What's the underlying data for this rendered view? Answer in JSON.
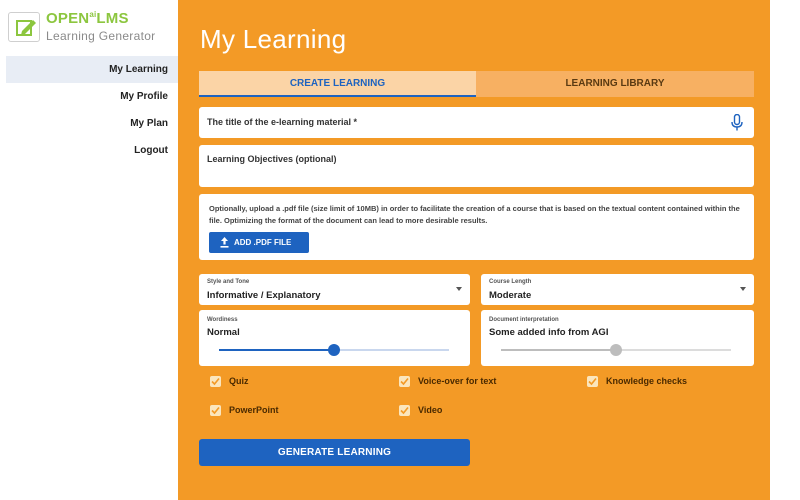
{
  "brand": {
    "name_part1": "OPEN",
    "name_part2": "LMS",
    "subtitle": "Learning Generator"
  },
  "sidebar": {
    "items": [
      {
        "label": "My Learning",
        "active": true
      },
      {
        "label": "My Profile",
        "active": false
      },
      {
        "label": "My Plan",
        "active": false
      },
      {
        "label": "Logout",
        "active": false
      }
    ]
  },
  "main": {
    "title": "My Learning",
    "tabs": [
      {
        "label": "CREATE LEARNING",
        "active": true
      },
      {
        "label": "LEARNING LIBRARY",
        "active": false
      }
    ],
    "title_field": {
      "label": "The title of the e-learning material *",
      "icon": "microphone-icon"
    },
    "objectives_field": {
      "label": "Learning Objectives (optional)"
    },
    "upload": {
      "description": "Optionally, upload a .pdf file (size limit of 10MB) in order to facilitate the creation of a course that is based on the textual content contained within the file. Optimizing the format of the document can lead to more desirable results.",
      "button_label": "ADD .PDF FILE",
      "icon": "upload-icon"
    },
    "style_tone": {
      "label": "Style and Tone",
      "value": "Informative / Explanatory"
    },
    "course_length": {
      "label": "Course Length",
      "value": "Moderate"
    },
    "wordiness": {
      "label": "Wordiness",
      "value": "Normal",
      "level_fraction": 0.5
    },
    "doc_interpretation": {
      "label": "Document interpretation",
      "value": "Some added info from AGI",
      "level_fraction": 0.5
    },
    "checkboxes": [
      {
        "label": "Quiz",
        "checked": true
      },
      {
        "label": "Voice-over for text",
        "checked": true
      },
      {
        "label": "Knowledge checks",
        "checked": true
      },
      {
        "label": "PowerPoint",
        "checked": true
      },
      {
        "label": "Video",
        "checked": true
      }
    ],
    "generate_button": "GENERATE LEARNING"
  },
  "colors": {
    "panel": "#f39a26",
    "accent": "#1e63c0",
    "brand_green": "#8cc63f"
  }
}
